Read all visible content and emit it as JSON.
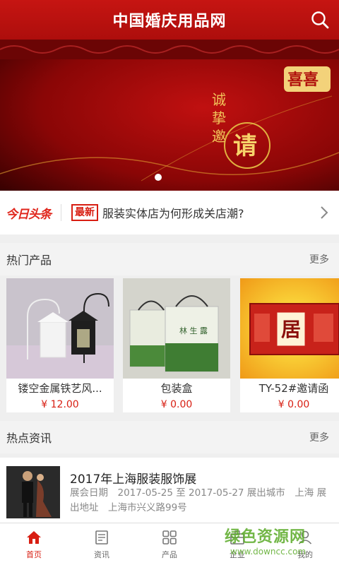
{
  "topbar": {
    "title": "中国婚庆用品网"
  },
  "banner": {
    "text_line1": "诚",
    "text_line2": "挚",
    "text_line3": "邀",
    "text_main": "请",
    "double_happiness": "喜喜"
  },
  "headline": {
    "logo": "今日头条",
    "badge": "最新",
    "text": "服装实体店为何形成关店潮?"
  },
  "hot_products": {
    "title": "热门产品",
    "more": "更多",
    "items": [
      {
        "name": "镂空金属铁艺风...",
        "price": "¥ 12.00"
      },
      {
        "name": "包装盒",
        "price": "¥ 0.00"
      },
      {
        "name": "TY-52#邀请函",
        "price": "¥ 0.00"
      }
    ]
  },
  "hot_news": {
    "title": "热点资讯",
    "more": "更多",
    "items": [
      {
        "title": "2017年上海服装服饰展",
        "desc": "展会日期　2017-05-25 至 2017-05-27 展出城市　上海 展出地址　上海市兴义路99号"
      }
    ]
  },
  "tabbar": {
    "tabs": [
      {
        "label": "首页",
        "icon": "home-icon"
      },
      {
        "label": "资讯",
        "icon": "news-icon"
      },
      {
        "label": "产品",
        "icon": "grid-icon"
      },
      {
        "label": "企业",
        "icon": "company-icon"
      },
      {
        "label": "我的",
        "icon": "user-icon"
      }
    ]
  },
  "watermark": {
    "main": "绿色资源网",
    "sub": "www.downcc.com"
  },
  "colors": {
    "brand_red": "#c61512",
    "price_red": "#d81e12"
  }
}
